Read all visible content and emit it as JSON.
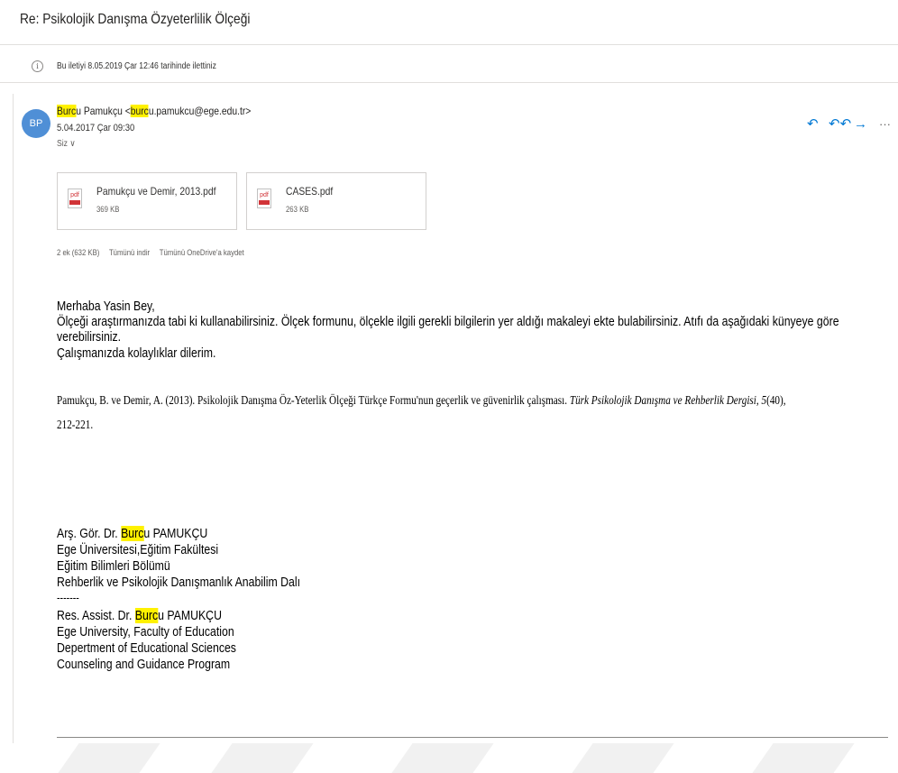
{
  "subject": "Re: Psikolojik Danışma Özyeterlilik Ölçeği",
  "info": {
    "icon": "info-icon",
    "text": "Bu iletiyi 8.05.2019 Çar 12:46 tarihinde ilettiniz"
  },
  "sender": {
    "initials": "BP",
    "avatar_color": "#4f8fd6",
    "name_highlight": "Burc",
    "name_rest": "u Pamukçu <",
    "email_highlight": "burc",
    "email_rest": "u.pamukcu@ege.edu.tr>",
    "date": "5.04.2017 Çar 09:30",
    "to": "Siz ∨"
  },
  "actions": {
    "reply_icon": "reply-icon",
    "reply_all_icon": "reply-all-icon",
    "forward_icon": "forward-icon",
    "more_icon": "more-icon",
    "reply_glyph": "↶",
    "reply_all_glyph": "↶↶",
    "forward_glyph": "→",
    "more_glyph": "···"
  },
  "attachments": [
    {
      "name": "Pamukçu ve Demir, 2013.pdf",
      "size": "369 KB",
      "icon_label": "pdf"
    },
    {
      "name": "CASES.pdf",
      "size": "263 KB",
      "icon_label": "pdf"
    }
  ],
  "attachment_summary": {
    "count": "2 ek (632 KB)",
    "download_all": "Tümünü indir",
    "save_onedrive": "Tümünü OneDrive'a kaydet"
  },
  "body": {
    "greeting": "Merhaba Yasin Bey,",
    "line1": "Ölçeği araştırmanızda tabi ki kullanabilirsiniz. Ölçek formunu, ölçekle ilgili gerekli bilgilerin yer aldığı makaleyi ekte bulabilirsiniz. Atıfı da aşağıdaki künyeye göre",
    "line2": "verebilirsiniz.",
    "line3": "Çalışmanızda kolaylıklar dilerim."
  },
  "reference": {
    "part1": "Pamukçu, B. ve Demir, A. (2013). Psikolojik Danışma Öz-Yeterlik Ölçeği Türkçe Formu'nun geçerlik ve güvenirlik çalışması. ",
    "journal": "Türk Psikolojik Danışma ve Rehberlik Dergisi",
    "part2": ", ",
    "volume": "5",
    "part3": "(40),",
    "pages": "212-221."
  },
  "signature": {
    "tr_prefix": "Arş. Gör. Dr. ",
    "tr_highlight": "Burc",
    "tr_rest": "u PAMUKÇU",
    "tr_line2": "Ege Üniversitesi,Eğitim Fakültesi",
    "tr_line3": "Eğitim Bilimleri Bölümü",
    "tr_line4": "Rehberlik ve Psikolojik Danışmanlık Anabilim Dalı",
    "separator": "-------",
    "en_prefix": "Res. Assist. Dr. ",
    "en_highlight": "Burc",
    "en_rest": "u PAMUKÇU",
    "en_line2": "Ege University, Faculty of Education",
    "en_line3": "Depertment of Educational Sciences",
    "en_line4": "Counseling and Guidance Program"
  },
  "colors": {
    "accent": "#0078d4",
    "highlight": "#fff100"
  }
}
